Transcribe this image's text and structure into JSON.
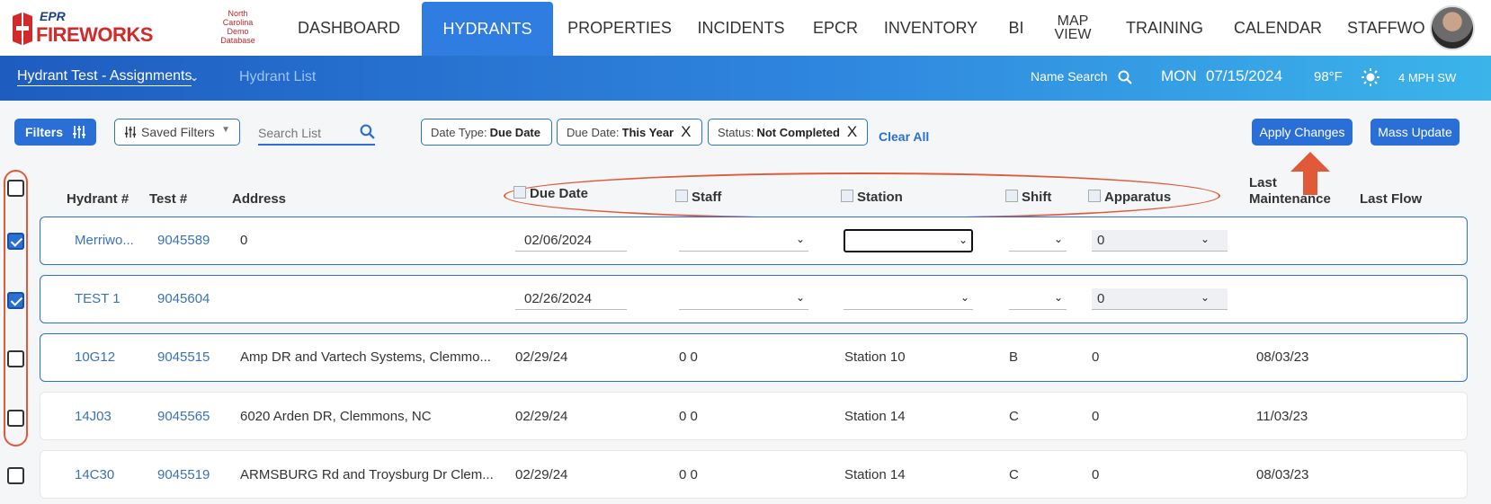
{
  "brand": {
    "top": "EPR",
    "name": "FIREWORKS"
  },
  "database_label": "North Carolina Demo Database",
  "nav": [
    {
      "label": "DASHBOARD"
    },
    {
      "label": "HYDRANTS"
    },
    {
      "label": "PROPERTIES"
    },
    {
      "label": "INCIDENTS"
    },
    {
      "label": "EPCR"
    },
    {
      "label": "INVENTORY"
    },
    {
      "label": "BI"
    },
    {
      "label": "MAP VIEW"
    },
    {
      "label": "TRAINING"
    },
    {
      "label": "CALENDAR"
    },
    {
      "label": "STAFFWO"
    }
  ],
  "subbar": {
    "title": "Hydrant Test - Assignments",
    "list_link": "Hydrant List",
    "name_search": "Name Search",
    "day": "MON",
    "date": "07/15/2024",
    "temp": "98°F",
    "wind": "4 MPH SW"
  },
  "filters": {
    "filters_btn": "Filters",
    "saved_filters": "Saved Filters",
    "search_placeholder": "Search List",
    "chips": [
      {
        "key": "Date Type:",
        "value": "Due Date",
        "removable": false
      },
      {
        "key": "Due Date:",
        "value": "This Year",
        "removable": true
      },
      {
        "key": "Status:",
        "value": "Not Completed",
        "removable": true
      }
    ],
    "clear_all": "Clear All",
    "apply_changes": "Apply Changes",
    "mass_update": "Mass Update"
  },
  "columns": {
    "hydrant": "Hydrant #",
    "test": "Test #",
    "address": "Address",
    "due_date": "Due Date",
    "staff": "Staff",
    "station": "Station",
    "shift": "Shift",
    "apparatus": "Apparatus",
    "last_maintenance_1": "Last",
    "last_maintenance_2": "Maintenance",
    "last_flow": "Last Flow"
  },
  "rows": [
    {
      "hydrant": "Merriwo...",
      "test": "9045589",
      "address": "0",
      "due_date": "02/06/2024",
      "staff": "",
      "station": "",
      "shift": "",
      "apparatus": "0",
      "last_maintenance": "",
      "last_flow": ""
    },
    {
      "hydrant": "TEST 1",
      "test": "9045604",
      "address": "",
      "due_date": "02/26/2024",
      "staff": "",
      "station": "",
      "shift": "",
      "apparatus": "0",
      "last_maintenance": "",
      "last_flow": ""
    },
    {
      "hydrant": "10G12",
      "test": "9045515",
      "address": "Amp DR and Vartech Systems, Clemmo...",
      "due_date": "02/29/24",
      "staff": "0 0",
      "station": "Station 10",
      "shift": "B",
      "apparatus": "0",
      "last_maintenance": "08/03/23",
      "last_flow": ""
    },
    {
      "hydrant": "14J03",
      "test": "9045565",
      "address": "6020 Arden DR, Clemmons, NC",
      "due_date": "02/29/24",
      "staff": "0 0",
      "station": "Station 14",
      "shift": "C",
      "apparatus": "0",
      "last_maintenance": "11/03/23",
      "last_flow": ""
    },
    {
      "hydrant": "14C30",
      "test": "9045519",
      "address": "ARMSBURG Rd and Troysburg Dr Clem...",
      "due_date": "02/29/24",
      "staff": "0 0",
      "station": "Station 14",
      "shift": "C",
      "apparatus": "0",
      "last_maintenance": "08/03/23",
      "last_flow": ""
    }
  ],
  "colors": {
    "accent": "#2a6fd6",
    "annotation": "#e05a3a",
    "brand_red": "#d22a2a"
  }
}
